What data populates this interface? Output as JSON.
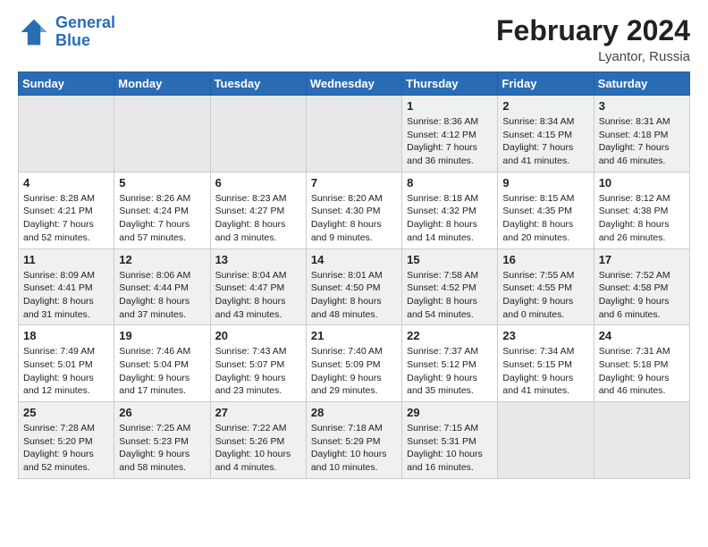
{
  "header": {
    "logo_line1": "General",
    "logo_line2": "Blue",
    "month_year": "February 2024",
    "location": "Lyantor, Russia"
  },
  "weekdays": [
    "Sunday",
    "Monday",
    "Tuesday",
    "Wednesday",
    "Thursday",
    "Friday",
    "Saturday"
  ],
  "weeks": [
    [
      {
        "day": "",
        "info": ""
      },
      {
        "day": "",
        "info": ""
      },
      {
        "day": "",
        "info": ""
      },
      {
        "day": "",
        "info": ""
      },
      {
        "day": "1",
        "info": "Sunrise: 8:36 AM\nSunset: 4:12 PM\nDaylight: 7 hours\nand 36 minutes."
      },
      {
        "day": "2",
        "info": "Sunrise: 8:34 AM\nSunset: 4:15 PM\nDaylight: 7 hours\nand 41 minutes."
      },
      {
        "day": "3",
        "info": "Sunrise: 8:31 AM\nSunset: 4:18 PM\nDaylight: 7 hours\nand 46 minutes."
      }
    ],
    [
      {
        "day": "4",
        "info": "Sunrise: 8:28 AM\nSunset: 4:21 PM\nDaylight: 7 hours\nand 52 minutes."
      },
      {
        "day": "5",
        "info": "Sunrise: 8:26 AM\nSunset: 4:24 PM\nDaylight: 7 hours\nand 57 minutes."
      },
      {
        "day": "6",
        "info": "Sunrise: 8:23 AM\nSunset: 4:27 PM\nDaylight: 8 hours\nand 3 minutes."
      },
      {
        "day": "7",
        "info": "Sunrise: 8:20 AM\nSunset: 4:30 PM\nDaylight: 8 hours\nand 9 minutes."
      },
      {
        "day": "8",
        "info": "Sunrise: 8:18 AM\nSunset: 4:32 PM\nDaylight: 8 hours\nand 14 minutes."
      },
      {
        "day": "9",
        "info": "Sunrise: 8:15 AM\nSunset: 4:35 PM\nDaylight: 8 hours\nand 20 minutes."
      },
      {
        "day": "10",
        "info": "Sunrise: 8:12 AM\nSunset: 4:38 PM\nDaylight: 8 hours\nand 26 minutes."
      }
    ],
    [
      {
        "day": "11",
        "info": "Sunrise: 8:09 AM\nSunset: 4:41 PM\nDaylight: 8 hours\nand 31 minutes."
      },
      {
        "day": "12",
        "info": "Sunrise: 8:06 AM\nSunset: 4:44 PM\nDaylight: 8 hours\nand 37 minutes."
      },
      {
        "day": "13",
        "info": "Sunrise: 8:04 AM\nSunset: 4:47 PM\nDaylight: 8 hours\nand 43 minutes."
      },
      {
        "day": "14",
        "info": "Sunrise: 8:01 AM\nSunset: 4:50 PM\nDaylight: 8 hours\nand 48 minutes."
      },
      {
        "day": "15",
        "info": "Sunrise: 7:58 AM\nSunset: 4:52 PM\nDaylight: 8 hours\nand 54 minutes."
      },
      {
        "day": "16",
        "info": "Sunrise: 7:55 AM\nSunset: 4:55 PM\nDaylight: 9 hours\nand 0 minutes."
      },
      {
        "day": "17",
        "info": "Sunrise: 7:52 AM\nSunset: 4:58 PM\nDaylight: 9 hours\nand 6 minutes."
      }
    ],
    [
      {
        "day": "18",
        "info": "Sunrise: 7:49 AM\nSunset: 5:01 PM\nDaylight: 9 hours\nand 12 minutes."
      },
      {
        "day": "19",
        "info": "Sunrise: 7:46 AM\nSunset: 5:04 PM\nDaylight: 9 hours\nand 17 minutes."
      },
      {
        "day": "20",
        "info": "Sunrise: 7:43 AM\nSunset: 5:07 PM\nDaylight: 9 hours\nand 23 minutes."
      },
      {
        "day": "21",
        "info": "Sunrise: 7:40 AM\nSunset: 5:09 PM\nDaylight: 9 hours\nand 29 minutes."
      },
      {
        "day": "22",
        "info": "Sunrise: 7:37 AM\nSunset: 5:12 PM\nDaylight: 9 hours\nand 35 minutes."
      },
      {
        "day": "23",
        "info": "Sunrise: 7:34 AM\nSunset: 5:15 PM\nDaylight: 9 hours\nand 41 minutes."
      },
      {
        "day": "24",
        "info": "Sunrise: 7:31 AM\nSunset: 5:18 PM\nDaylight: 9 hours\nand 46 minutes."
      }
    ],
    [
      {
        "day": "25",
        "info": "Sunrise: 7:28 AM\nSunset: 5:20 PM\nDaylight: 9 hours\nand 52 minutes."
      },
      {
        "day": "26",
        "info": "Sunrise: 7:25 AM\nSunset: 5:23 PM\nDaylight: 9 hours\nand 58 minutes."
      },
      {
        "day": "27",
        "info": "Sunrise: 7:22 AM\nSunset: 5:26 PM\nDaylight: 10 hours\nand 4 minutes."
      },
      {
        "day": "28",
        "info": "Sunrise: 7:18 AM\nSunset: 5:29 PM\nDaylight: 10 hours\nand 10 minutes."
      },
      {
        "day": "29",
        "info": "Sunrise: 7:15 AM\nSunset: 5:31 PM\nDaylight: 10 hours\nand 16 minutes."
      },
      {
        "day": "",
        "info": ""
      },
      {
        "day": "",
        "info": ""
      }
    ]
  ]
}
